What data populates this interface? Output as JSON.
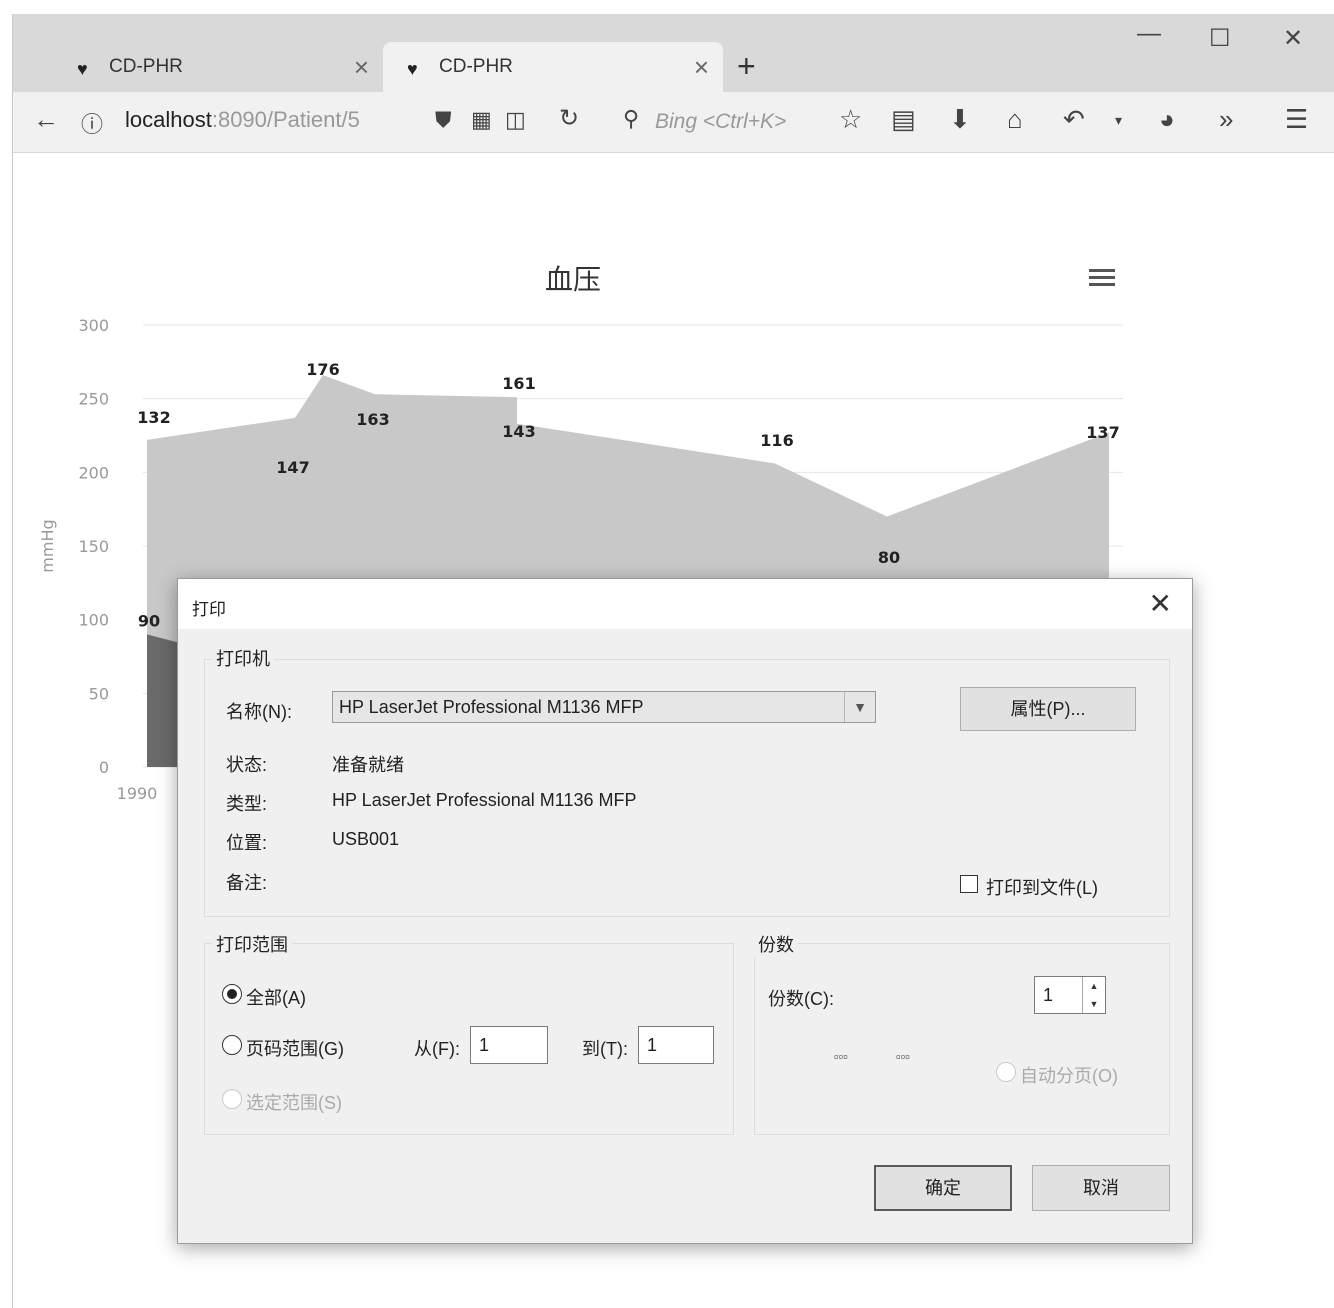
{
  "browser": {
    "tabs": [
      {
        "label": "CD-PHR",
        "active": false
      },
      {
        "label": "CD-PHR",
        "active": true
      }
    ],
    "new_tab": "+",
    "window_controls": {
      "minimize": "—",
      "maximize": "☐",
      "close": "✕"
    },
    "url": {
      "host": "localhost",
      "rest": ":8090/Patient/5"
    },
    "search_placeholder": "Bing <Ctrl+K>",
    "icons": [
      "back-arrow-icon",
      "info-icon",
      "shield-icon",
      "qr-code-icon",
      "reader-icon",
      "reload-icon",
      "search-icon",
      "bookmark-star-icon",
      "clipboard-icon",
      "download-icon",
      "home-icon",
      "undo-icon",
      "dropdown-icon",
      "palette-icon",
      "overflow-icon",
      "menu-icon"
    ]
  },
  "chart_data": {
    "type": "area",
    "title": "血压",
    "ylabel": "mmHg",
    "ylim": [
      0,
      300
    ],
    "y_ticks": [
      "0",
      "50",
      "100",
      "150",
      "200",
      "250",
      "300"
    ],
    "x_tick_visible": "1990",
    "grid": true,
    "series": [
      {
        "color": "#c8c8c8",
        "values": [
          132,
          147,
          176,
          163,
          161,
          143,
          116,
          80,
          137
        ],
        "labels": [
          "132",
          "147",
          "176",
          "163",
          "161",
          "143",
          "116",
          "80",
          "137"
        ]
      },
      {
        "color": "#6a6a6a",
        "values": [
          90
        ],
        "labels": [
          "90"
        ]
      }
    ]
  },
  "dialog": {
    "title": "打印",
    "close": "✕",
    "printer_group": "打印机",
    "name_label": "名称(N):",
    "name_value": "HP LaserJet Professional M1136 MFP",
    "properties_button": "属性(P)...",
    "status_label": "状态:",
    "status_value": "准备就绪",
    "type_label": "类型:",
    "type_value": "HP LaserJet Professional M1136 MFP",
    "location_label": "位置:",
    "location_value": "USB001",
    "comment_label": "备注:",
    "print_to_file": "打印到文件(L)",
    "range_group": "打印范围",
    "range_all": "全部(A)",
    "range_pages": "页码范围(G)",
    "range_selection": "选定范围(S)",
    "from_label": "从(F):",
    "from_value": "1",
    "to_label": "到(T):",
    "to_value": "1",
    "copies_group": "份数",
    "copies_label": "份数(C):",
    "copies_value": "1",
    "collate": "自动分页(O)",
    "ok_button": "确定",
    "cancel_button": "取消"
  }
}
